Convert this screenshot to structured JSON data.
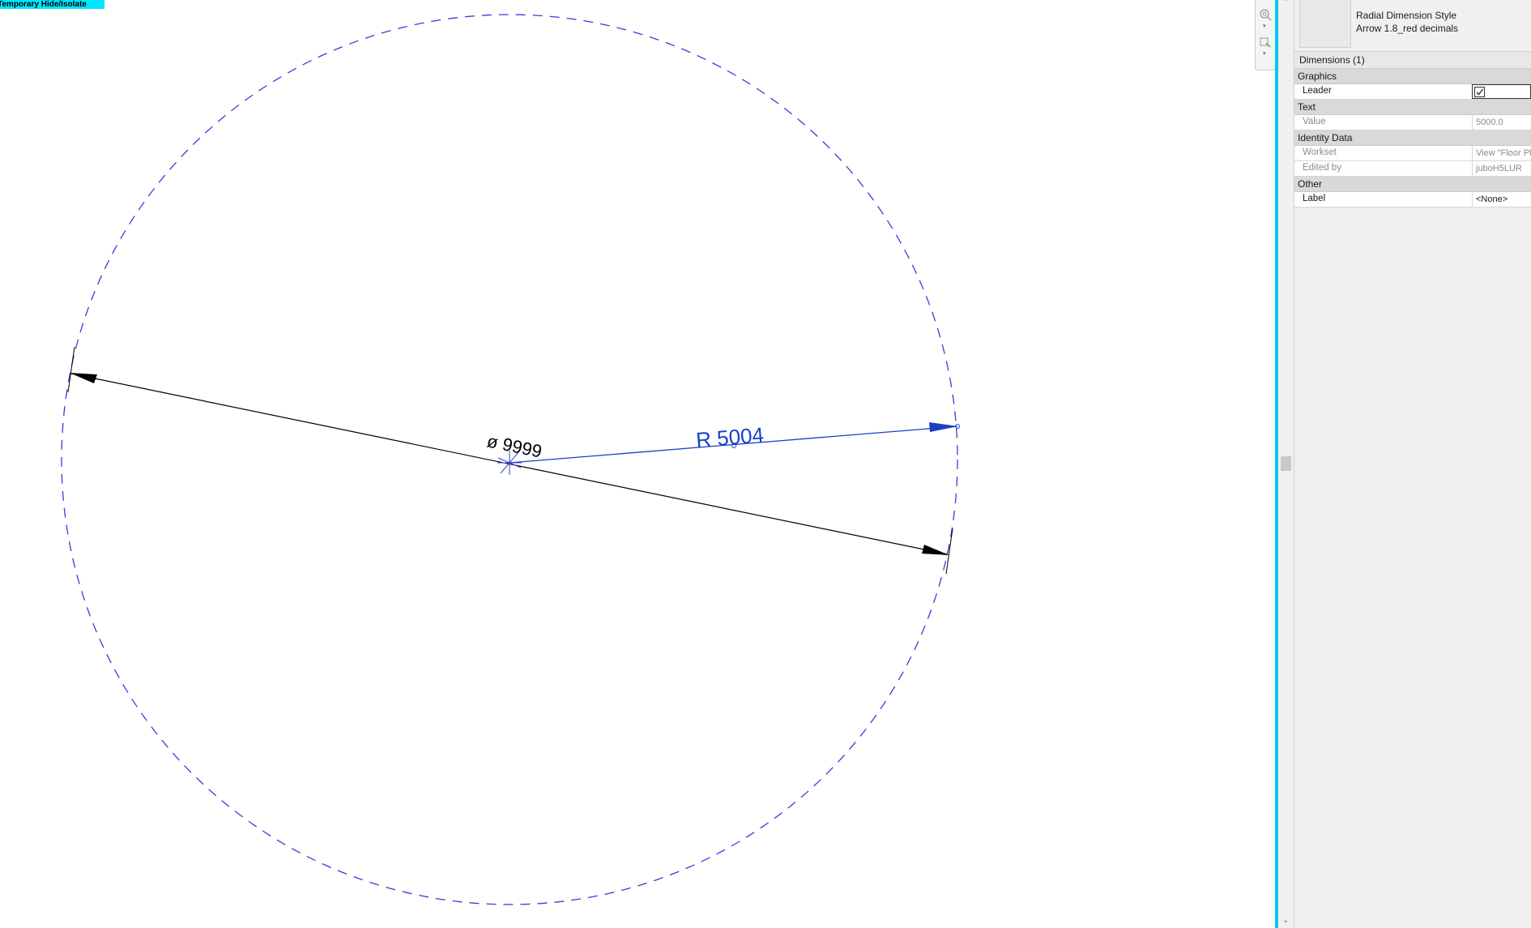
{
  "app": {
    "banner": "Temporary Hide/Isolate"
  },
  "drawing": {
    "diameter_label": "ø 9999",
    "radius_label": "R 5004",
    "circle_color": "#3a3ae0",
    "radius_color": "#1b3fc4",
    "diameter_color": "#000000"
  },
  "navigation_bar": {
    "icons": [
      "zoom-icon",
      "pan-icon"
    ]
  },
  "properties": {
    "type_selector": {
      "family": "Radial Dimension Style",
      "type": "Arrow 1.8_red decimals"
    },
    "instance_filter": "Dimensions (1)",
    "groups": [
      {
        "name": "Graphics",
        "rows": [
          {
            "name": "Leader",
            "value": "",
            "checked": true,
            "editable": true
          }
        ]
      },
      {
        "name": "Text",
        "rows": [
          {
            "name": "Value",
            "value": "5000.0",
            "editable": false
          }
        ]
      },
      {
        "name": "Identity Data",
        "rows": [
          {
            "name": "Workset",
            "value": "View \"Floor Plan",
            "editable": false
          },
          {
            "name": "Edited by",
            "value": "juboH5LUR",
            "editable": false
          }
        ]
      },
      {
        "name": "Other",
        "rows": [
          {
            "name": "Label",
            "value": "<None>",
            "editable": true
          }
        ]
      }
    ]
  },
  "colors": {
    "accent_splitter": "#00c8f0",
    "banner_bg": "#00e5ff"
  }
}
